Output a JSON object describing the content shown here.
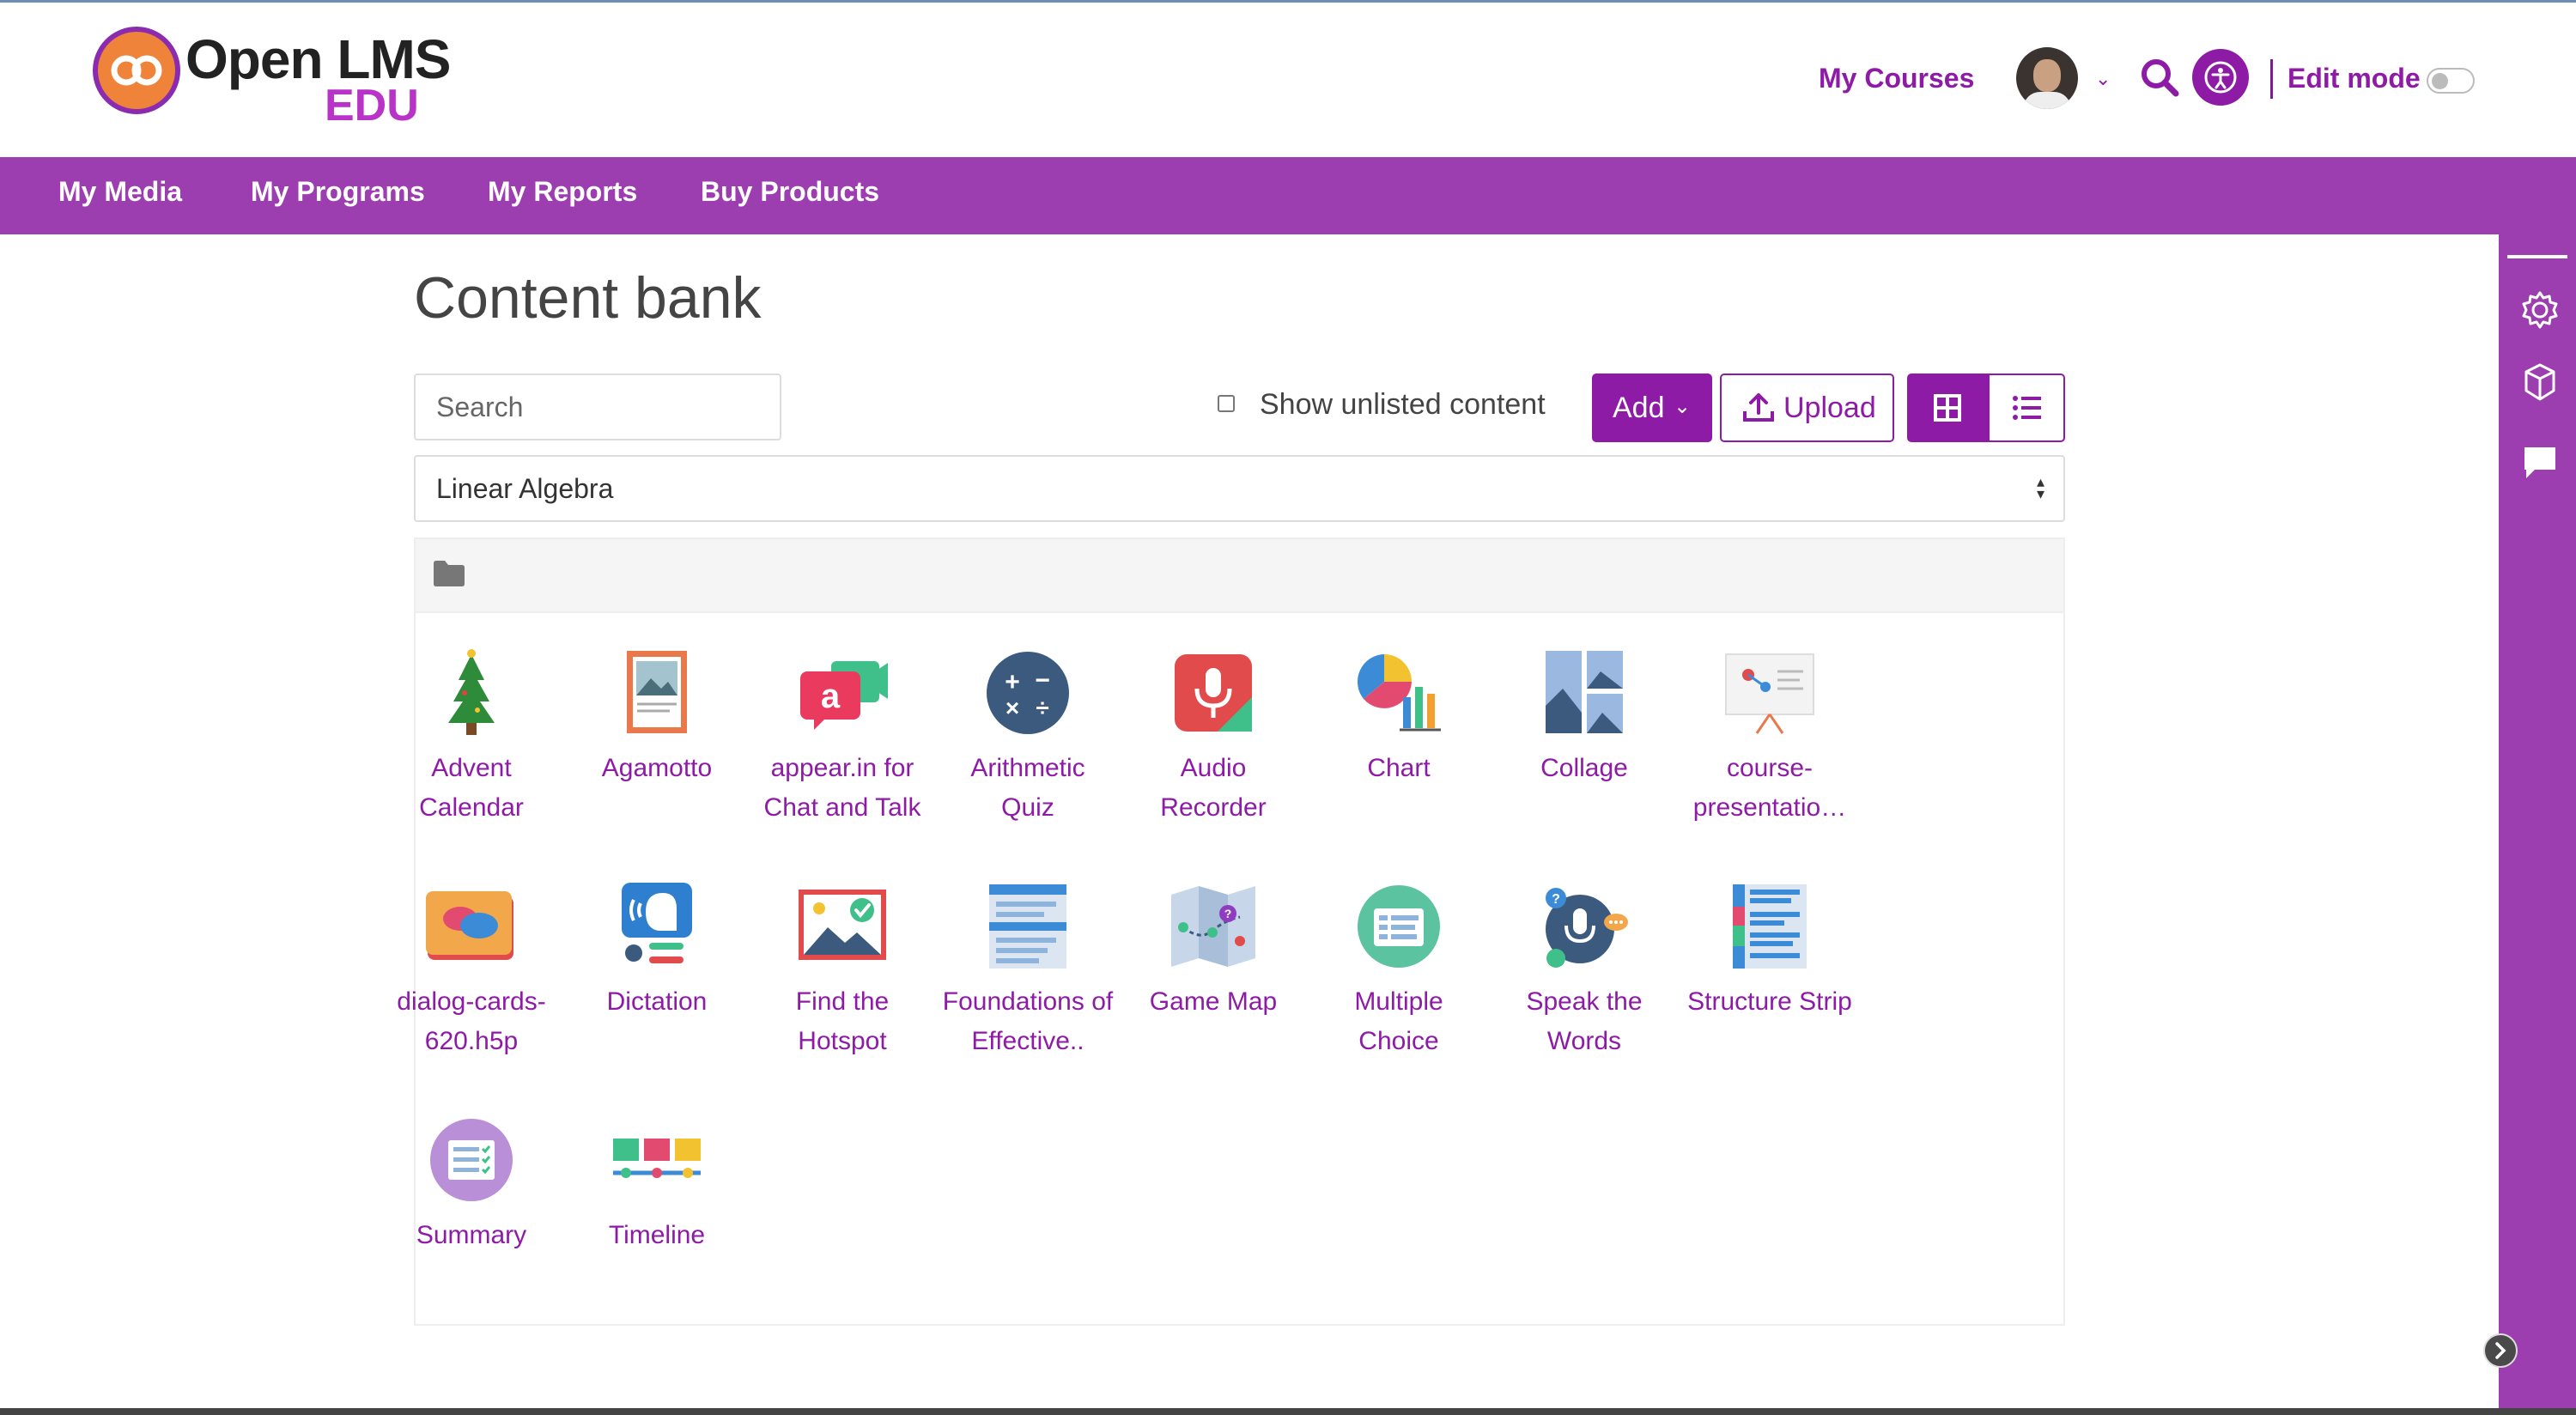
{
  "header": {
    "logo_line1": "Open LMS",
    "logo_line2": "EDU",
    "my_courses": "My Courses",
    "edit_mode": "Edit mode"
  },
  "primary_nav": [
    "My Media",
    "My Programs",
    "My Reports",
    "Buy Products"
  ],
  "page": {
    "title": "Content bank",
    "search_placeholder": "Search",
    "show_unlisted": "Show unlisted content",
    "add_label": "Add",
    "upload_label": "Upload",
    "context_selected": "Linear Algebra"
  },
  "content_items": [
    {
      "label": "Advent Calendar",
      "icon": "advent-calendar-icon"
    },
    {
      "label": "Agamotto",
      "icon": "agamotto-icon"
    },
    {
      "label": "appear.in for Chat and Talk",
      "icon": "appear-in-icon"
    },
    {
      "label": "Arithmetic Quiz",
      "icon": "arithmetic-quiz-icon"
    },
    {
      "label": "Audio Recorder",
      "icon": "audio-recorder-icon"
    },
    {
      "label": "Chart",
      "icon": "chart-icon"
    },
    {
      "label": "Collage",
      "icon": "collage-icon"
    },
    {
      "label": "course-presentatio…",
      "icon": "course-presentation-icon"
    },
    {
      "label": "dialog-cards-620.h5p",
      "icon": "dialog-cards-icon"
    },
    {
      "label": "Dictation",
      "icon": "dictation-icon"
    },
    {
      "label": "Find the Hotspot",
      "icon": "find-hotspot-icon"
    },
    {
      "label": "Foundations of Effective..",
      "icon": "foundations-icon"
    },
    {
      "label": "Game Map",
      "icon": "game-map-icon"
    },
    {
      "label": "Multiple Choice",
      "icon": "multiple-choice-icon"
    },
    {
      "label": "Speak the Words",
      "icon": "speak-words-icon"
    },
    {
      "label": "Structure Strip",
      "icon": "structure-strip-icon"
    },
    {
      "label": "Summary",
      "icon": "summary-icon"
    },
    {
      "label": "Timeline",
      "icon": "timeline-icon"
    }
  ],
  "colors": {
    "brand_purple": "#8e1ba6",
    "nav_purple": "#9c3db0",
    "logo_orange": "#f0833a",
    "logo_edu": "#b933c9"
  }
}
